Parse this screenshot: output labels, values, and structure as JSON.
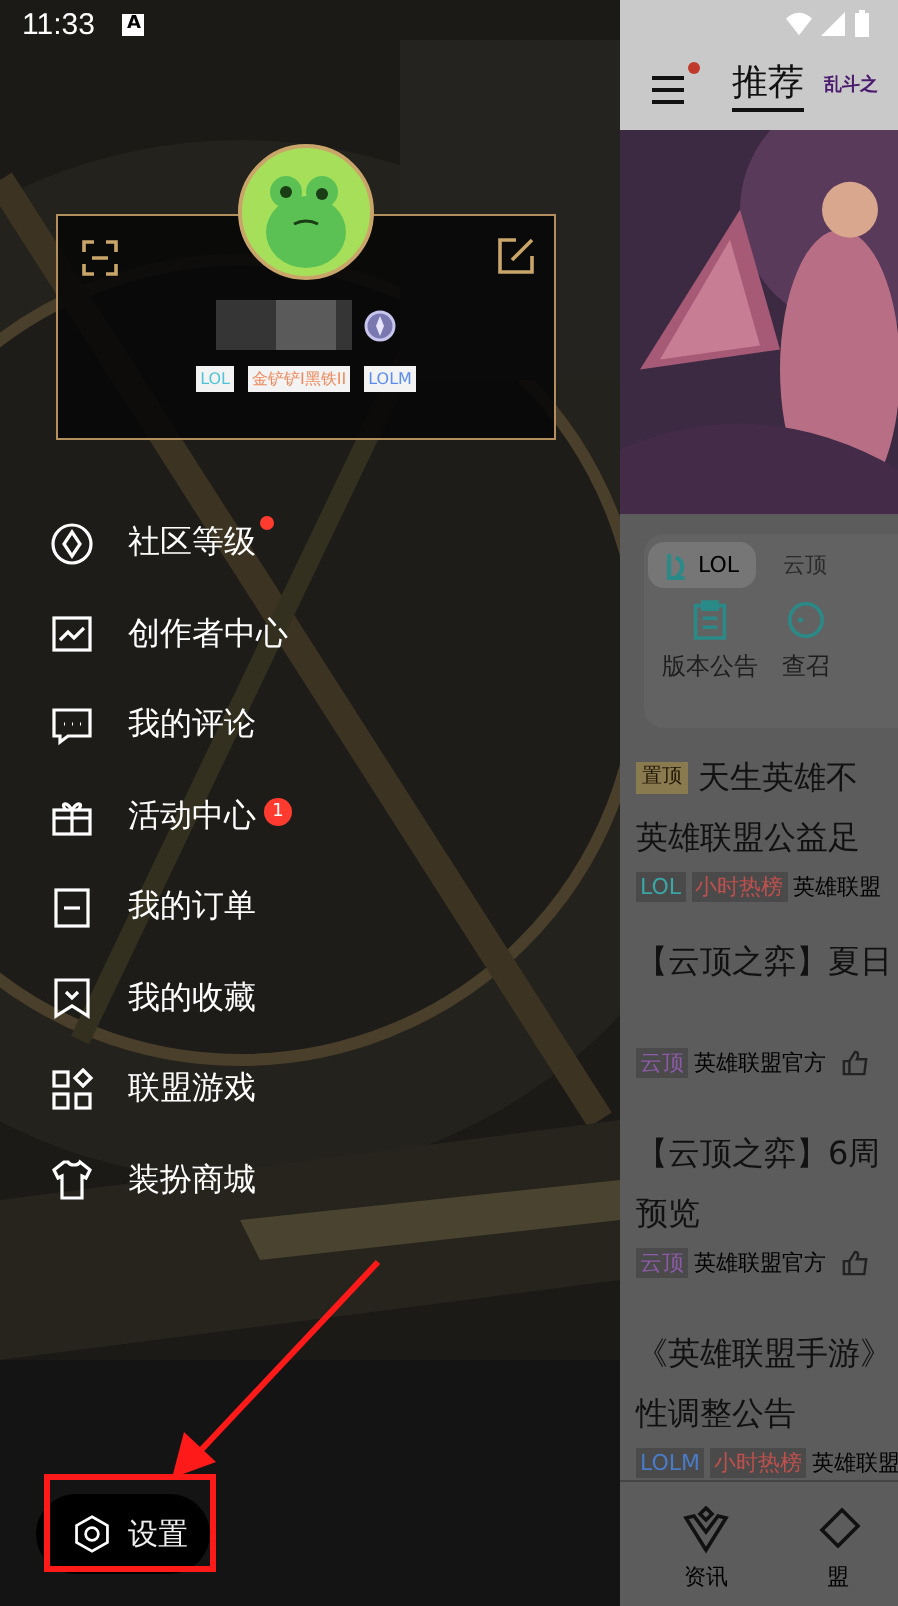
{
  "status_bar": {
    "time": "11:33",
    "notification": "A"
  },
  "profile": {
    "tags": [
      {
        "label": "LOL",
        "color": "#4fc3d9"
      },
      {
        "label": "金铲铲I黑铁II",
        "color": "#f08a5d"
      },
      {
        "label": "LOLM",
        "color": "#5b8def"
      }
    ]
  },
  "menu": [
    {
      "label": "社区等级",
      "dot": true
    },
    {
      "label": "创作者中心",
      "dot": false
    },
    {
      "label": "我的评论",
      "dot": false
    },
    {
      "label": "活动中心",
      "dot": false,
      "badge": "1"
    },
    {
      "label": "我的订单",
      "dot": false
    },
    {
      "label": "我的收藏",
      "dot": false
    },
    {
      "label": "联盟游戏",
      "dot": false
    },
    {
      "label": "装扮商城",
      "dot": false
    }
  ],
  "settings_button": {
    "label": "设置"
  },
  "main": {
    "header": {
      "title": "推荐",
      "menu_dot": true,
      "promo": "乱斗之"
    },
    "game_tabs": [
      {
        "label": "LOL",
        "selected": true
      },
      {
        "label": "云顶",
        "selected": false
      }
    ],
    "shortcuts": [
      "版本公告",
      "查召"
    ],
    "feed": [
      {
        "pinned": "置顶",
        "lines": [
          "天生英雄不",
          "英雄联盟公益足"
        ],
        "tags": [
          {
            "label": "LOL",
            "color": "#3aa6a6"
          },
          {
            "label": "小时热榜",
            "color": "#c0504d"
          }
        ],
        "source": "英雄联盟"
      },
      {
        "lines": [
          "【云顶之弈】夏日"
        ],
        "tags": [
          {
            "label": "云顶",
            "color": "#8e5aa8"
          }
        ],
        "source": "英雄联盟官方",
        "like": true
      },
      {
        "lines": [
          "【云顶之弈】6周",
          "预览"
        ],
        "tags": [
          {
            "label": "云顶",
            "color": "#8e5aa8"
          }
        ],
        "source": "英雄联盟官方",
        "like": true
      },
      {
        "lines": [
          "《英雄联盟手游》",
          "性调整公告"
        ],
        "tags": [
          {
            "label": "LOLM",
            "color": "#4a7bc8"
          },
          {
            "label": "小时热榜",
            "color": "#c0504d"
          }
        ],
        "source": "英雄联盟"
      }
    ],
    "bottom_nav": [
      {
        "label": "资讯"
      },
      {
        "label": "盟"
      }
    ]
  }
}
